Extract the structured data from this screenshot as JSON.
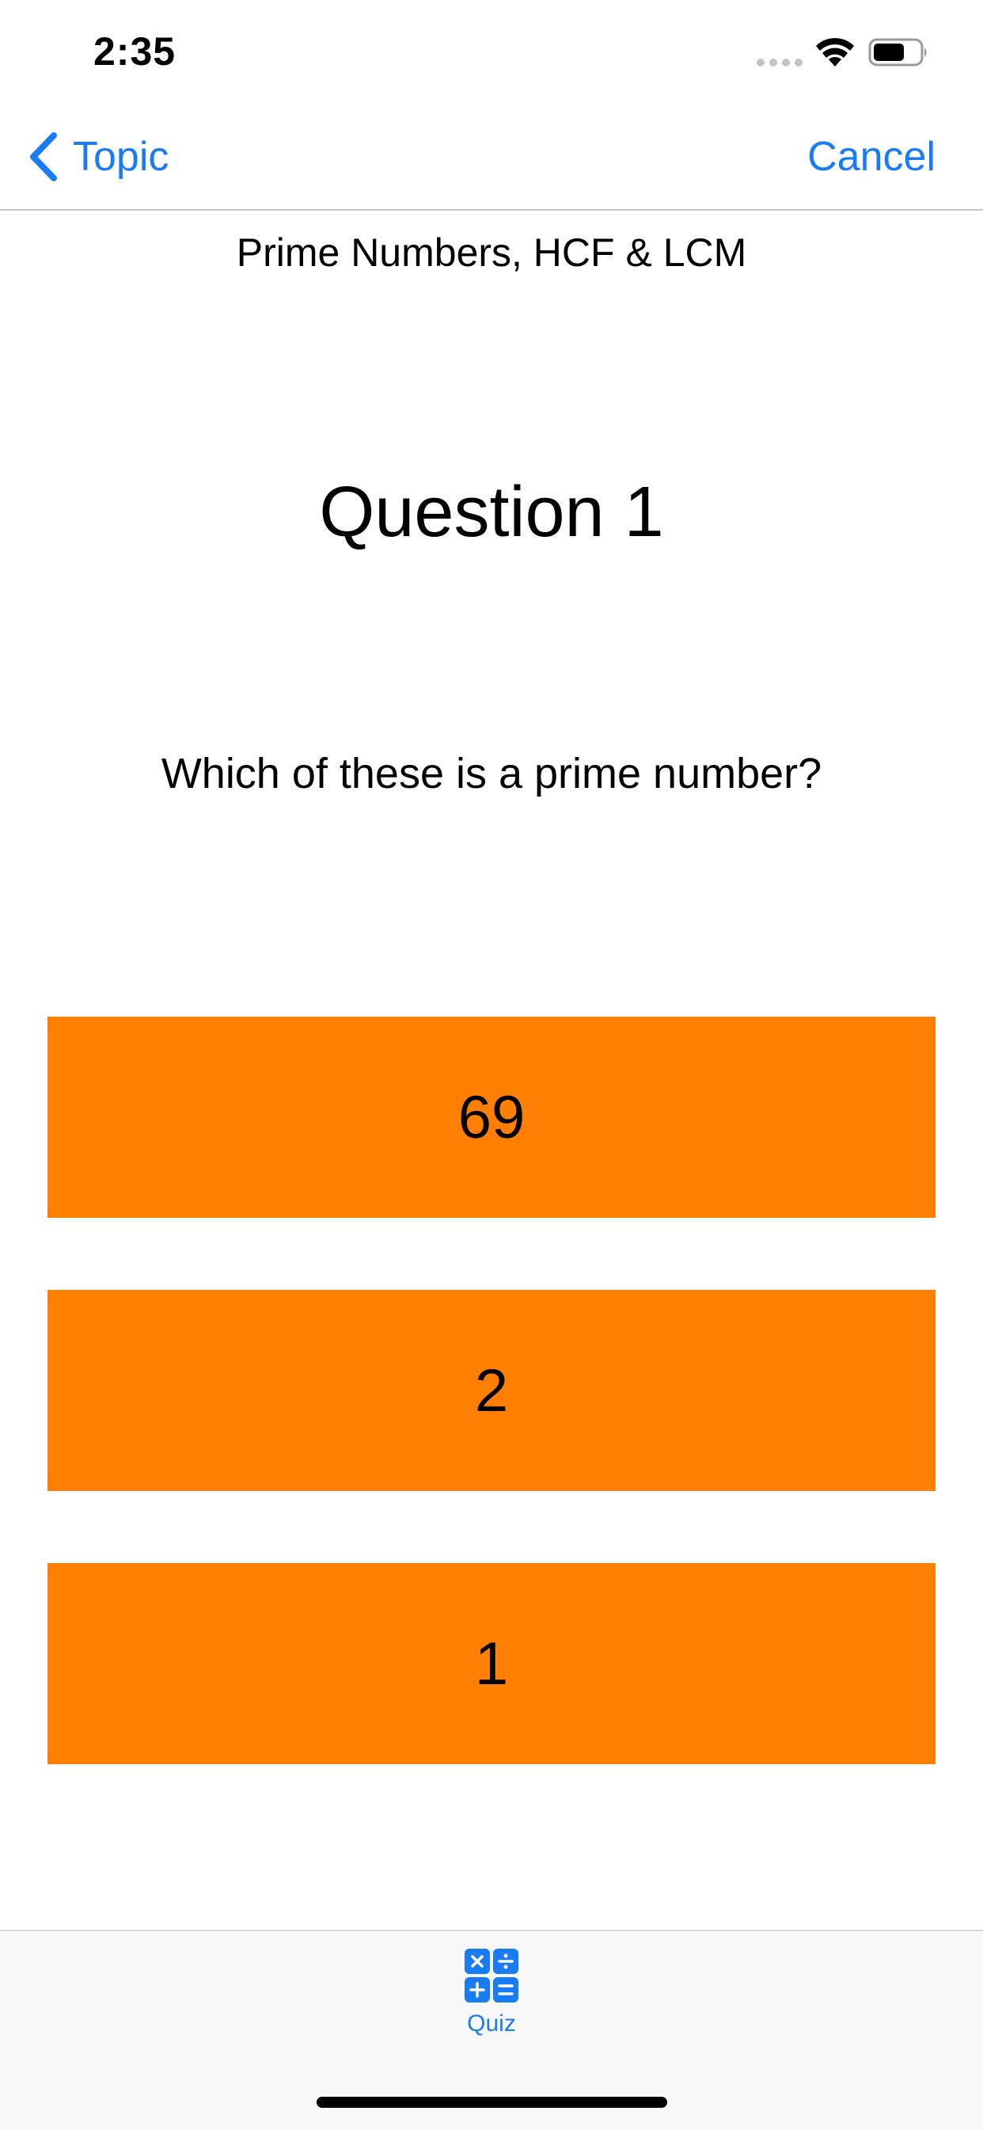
{
  "status_bar": {
    "time": "2:35",
    "icons": [
      "cellular-signal-icon",
      "wifi-icon",
      "battery-icon"
    ]
  },
  "nav": {
    "back_label": "Topic",
    "back_icon": "chevron-left-icon",
    "cancel_label": "Cancel"
  },
  "topic_title": "Prime Numbers, HCF & LCM",
  "question": {
    "heading": "Question 1",
    "text": "Which of these is a prime number?"
  },
  "answers": [
    {
      "label": "69"
    },
    {
      "label": "2"
    },
    {
      "label": "1"
    }
  ],
  "tab_bar": {
    "items": [
      {
        "label": "Quiz",
        "icon": "calculator-icon",
        "selected": true
      }
    ]
  },
  "colors": {
    "accent": "#1a7cf5",
    "answer_background": "#ff7f02",
    "tab_bar_background": "#f8f8f8"
  }
}
